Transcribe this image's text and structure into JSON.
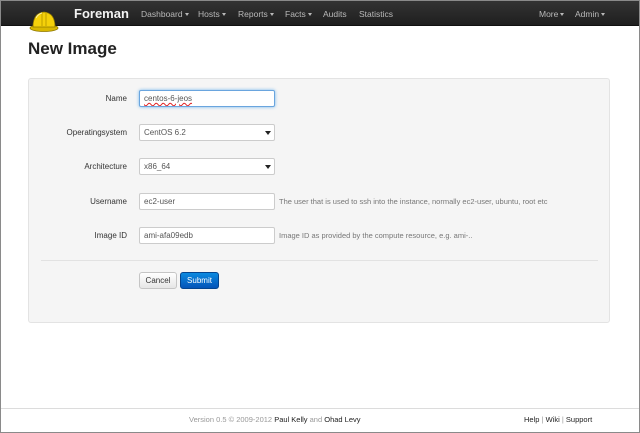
{
  "navbar": {
    "brand": "Foreman",
    "items": [
      {
        "label": "Dashboard"
      },
      {
        "label": "Hosts"
      },
      {
        "label": "Reports"
      },
      {
        "label": "Facts"
      },
      {
        "label": "Audits"
      },
      {
        "label": "Statistics"
      }
    ],
    "right_items": [
      {
        "label": "More"
      },
      {
        "label": "Admin"
      }
    ]
  },
  "page": {
    "title": "New Image"
  },
  "form": {
    "name": {
      "label": "Name",
      "value": "centos-6-jeos"
    },
    "os": {
      "label": "Operatingsystem",
      "value": "CentOS 6.2"
    },
    "arch": {
      "label": "Architecture",
      "value": "x86_64"
    },
    "username": {
      "label": "Username",
      "value": "ec2-user",
      "help": "The user that is used to ssh into the instance, normally ec2-user, ubuntu, root etc"
    },
    "image_id": {
      "label": "Image ID",
      "value": "ami-afa09edb",
      "help": "Image ID as provided by the compute resource, e.g. ami-.."
    },
    "cancel_label": "Cancel",
    "submit_label": "Submit"
  },
  "footer": {
    "version": "Version 0.5 © 2009-2012",
    "author1": "Paul Kelly",
    "and": "and",
    "author2": "Ohad Levy",
    "links": [
      "Help",
      "Wiki",
      "Support"
    ],
    "sep": "|"
  },
  "colors": {
    "navbar": "#222222",
    "primary_button": "#0a6ad0",
    "focus_border": "#6aa5de",
    "well": "#f5f5f5"
  },
  "icons": {
    "logo": "hardhat-icon",
    "caret": "caret-down-icon",
    "select": "select-arrow-icon"
  }
}
